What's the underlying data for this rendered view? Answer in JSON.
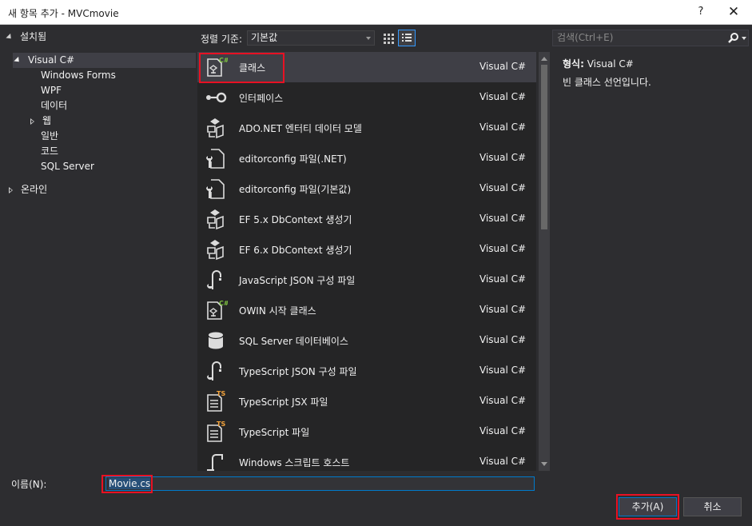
{
  "window": {
    "title": "새 항목 추가 - MVCmovie",
    "help_label": "?",
    "close_label": "✕"
  },
  "tree": {
    "installed": "설치됨",
    "visual_csharp": "Visual C#",
    "children": [
      "Windows Forms",
      "WPF",
      "데이터",
      "웹",
      "일반",
      "코드",
      "SQL Server"
    ],
    "online": "온라인"
  },
  "toolbar": {
    "sort_label": "정렬 기준:",
    "sort_value": "기본값",
    "search_placeholder": "검색(Ctrl+E)"
  },
  "templates": [
    {
      "name": "클래스",
      "lang": "Visual C#",
      "icon": "csharp-class-icon"
    },
    {
      "name": "인터페이스",
      "lang": "Visual C#",
      "icon": "interface-icon"
    },
    {
      "name": "ADO.NET 엔터티 데이터 모델",
      "lang": "Visual C#",
      "icon": "entity-model-icon"
    },
    {
      "name": "editorconfig 파일(.NET)",
      "lang": "Visual C#",
      "icon": "editorconfig-icon"
    },
    {
      "name": "editorconfig 파일(기본값)",
      "lang": "Visual C#",
      "icon": "editorconfig-icon"
    },
    {
      "name": "EF 5.x DbContext 생성기",
      "lang": "Visual C#",
      "icon": "entity-model-icon"
    },
    {
      "name": "EF 6.x DbContext 생성기",
      "lang": "Visual C#",
      "icon": "entity-model-icon"
    },
    {
      "name": "JavaScript JSON 구성 파일",
      "lang": "Visual C#",
      "icon": "json-config-icon"
    },
    {
      "name": "OWIN 시작 클래스",
      "lang": "Visual C#",
      "icon": "csharp-class-icon"
    },
    {
      "name": "SQL Server 데이터베이스",
      "lang": "Visual C#",
      "icon": "database-icon"
    },
    {
      "name": "TypeScript JSON 구성 파일",
      "lang": "Visual C#",
      "icon": "json-config-icon"
    },
    {
      "name": "TypeScript JSX 파일",
      "lang": "Visual C#",
      "icon": "typescript-file-icon"
    },
    {
      "name": "TypeScript 파일",
      "lang": "Visual C#",
      "icon": "typescript-file-icon"
    },
    {
      "name": "Windows 스크립트 호스트",
      "lang": "Visual C#",
      "icon": "script-host-icon"
    }
  ],
  "description": {
    "type_label": "형식:",
    "type_value": "Visual C#",
    "text": "빈 클래스 선언입니다."
  },
  "bottom": {
    "name_label": "이름(N):",
    "name_value": "Movie.cs",
    "add_label": "추가(A)",
    "cancel_label": "취소"
  },
  "colors": {
    "accent": "#007acc",
    "highlight": "#e81123",
    "typescript": "#f3a33c",
    "csharp": "#68217a"
  }
}
